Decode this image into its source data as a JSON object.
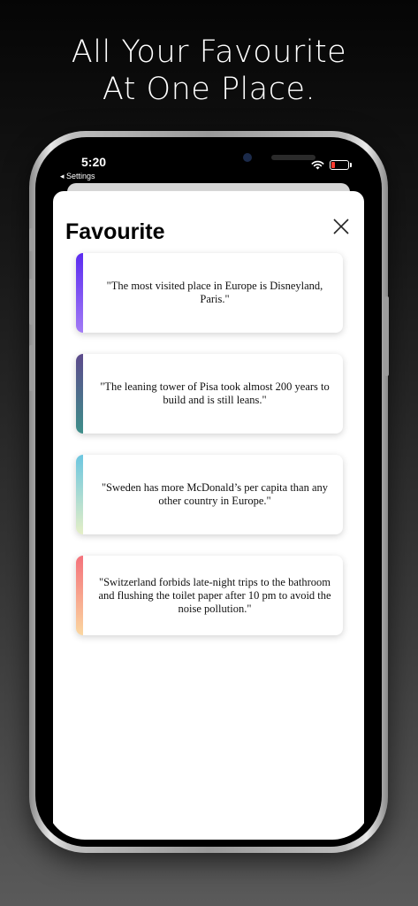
{
  "promo": {
    "line1": "All Your Favourite",
    "line2": "At One Place."
  },
  "status_bar": {
    "time": "5:20",
    "back_label": "◂ Settings"
  },
  "sheet": {
    "title": "Favourite",
    "close_icon": "close-icon"
  },
  "favourites": [
    {
      "text": "\"The most visited place in Europe is Disneyland, Paris.\"",
      "accent_from": "#5b2cf0",
      "accent_to": "#a27bf5"
    },
    {
      "text": "\"The leaning tower of Pisa took almost 200 years to build and is still leans.\"",
      "accent_from": "#5d4a8c",
      "accent_to": "#3e8f8a"
    },
    {
      "text": "\"Sweden has more McDonald’s per capita than any other country in Europe.\"",
      "accent_from": "#6cc6e0",
      "accent_to": "#e5efc6"
    },
    {
      "text": "\"Switzerland forbids late-night trips to the bathroom and flushing the toilet paper after 10 pm to avoid the noise pollution.\"",
      "accent_from": "#f4717b",
      "accent_to": "#fbd7a0"
    }
  ]
}
